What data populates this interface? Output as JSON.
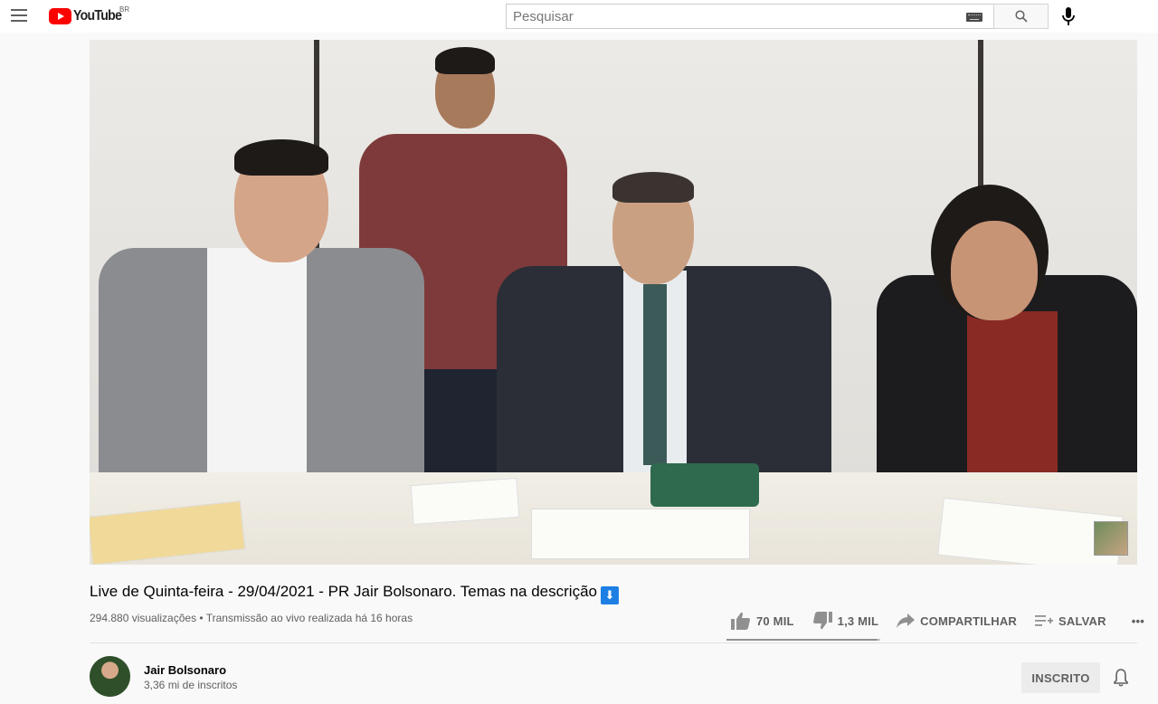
{
  "masthead": {
    "logo_text": "YouTube",
    "country_code": "BR",
    "search_placeholder": "Pesquisar",
    "icons": [
      "menu-icon",
      "keyboard-icon",
      "search-icon",
      "microphone-icon"
    ]
  },
  "video": {
    "title": "Live de Quinta-feira - 29/04/2021 - PR Jair Bolsonaro. Temas na descrição",
    "title_emoji": "⬇",
    "views": "294.880 visualizações",
    "separator": " • ",
    "stream_info": "Transmissão ao vivo realizada há 16 horas",
    "like_ratio": 0.98
  },
  "actions": {
    "likes": "70 MIL",
    "dislikes": "1,3 MIL",
    "share": "COMPARTILHAR",
    "save": "SALVAR",
    "more": "•••"
  },
  "channel": {
    "name": "Jair Bolsonaro",
    "subscribers": "3,36 mi de inscritos",
    "subscribe_label": "INSCRITO"
  },
  "colors": {
    "brand_red": "#ff0000",
    "text_primary": "#030303",
    "text_secondary": "#606060",
    "icon_gray": "#909090"
  }
}
